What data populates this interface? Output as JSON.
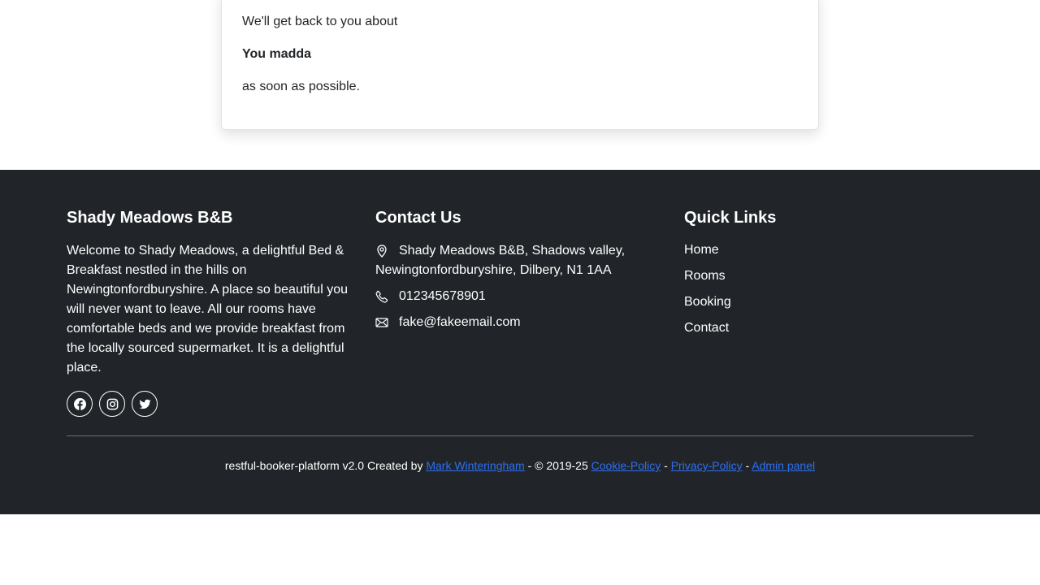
{
  "confirmation": {
    "line1": "We'll get back to you about",
    "subject": "You madda",
    "line3": "as soon as possible."
  },
  "footer": {
    "about": {
      "title": "Shady Meadows B&B",
      "text": "Welcome to Shady Meadows, a delightful Bed & Breakfast nestled in the hills on Newingtonfordburyshire. A place so beautiful you will never want to leave. All our rooms have comfortable beds and we provide breakfast from the locally sourced supermarket. It is a delightful place.",
      "socials": [
        "facebook-icon",
        "instagram-icon",
        "twitter-icon"
      ]
    },
    "contact": {
      "title": "Contact Us",
      "address": "Shady Meadows B&B, Shadows valley, Newingtonfordburyshire, Dilbery, N1 1AA",
      "phone": "012345678901",
      "email": "fake@fakeemail.com"
    },
    "quick_links": {
      "title": "Quick Links",
      "items": [
        "Home",
        "Rooms",
        "Booking",
        "Contact"
      ]
    },
    "bottom": {
      "prefix": "restful-booker-platform v2.0 Created by ",
      "author": "Mark Winteringham",
      "copyright": " - © 2019-25 ",
      "cookie": "Cookie-Policy",
      "sep1": " - ",
      "privacy": "Privacy-Policy",
      "sep2": " - ",
      "admin": "Admin panel"
    }
  },
  "colors": {
    "footer_bg": "#212529",
    "link": "#2d6ff0"
  }
}
